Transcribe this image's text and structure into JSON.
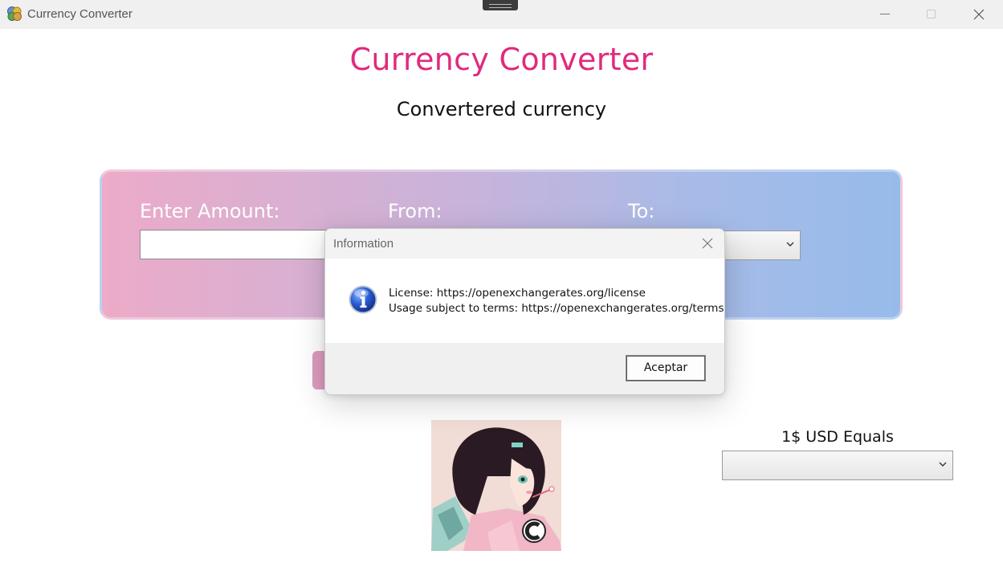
{
  "window": {
    "title": "Currency Converter",
    "icon": "currency-coins-icon"
  },
  "main": {
    "heading": "Currency Converter",
    "subheading": "Convertered currency",
    "accent_color": "#e02a7d",
    "panel": {
      "amount_label": "Enter Amount:",
      "amount_value": "",
      "from_label": "From:",
      "to_label": "To:",
      "to_value": ""
    },
    "usd_equals_label": "1$ USD Equals",
    "usd_equals_value": ""
  },
  "dialog": {
    "title": "Information",
    "icon": "info-icon",
    "line1": "License: https://openexchangerates.org/license",
    "line2": "Usage subject to terms: https://openexchangerates.org/terms",
    "ok_label": "Aceptar"
  }
}
